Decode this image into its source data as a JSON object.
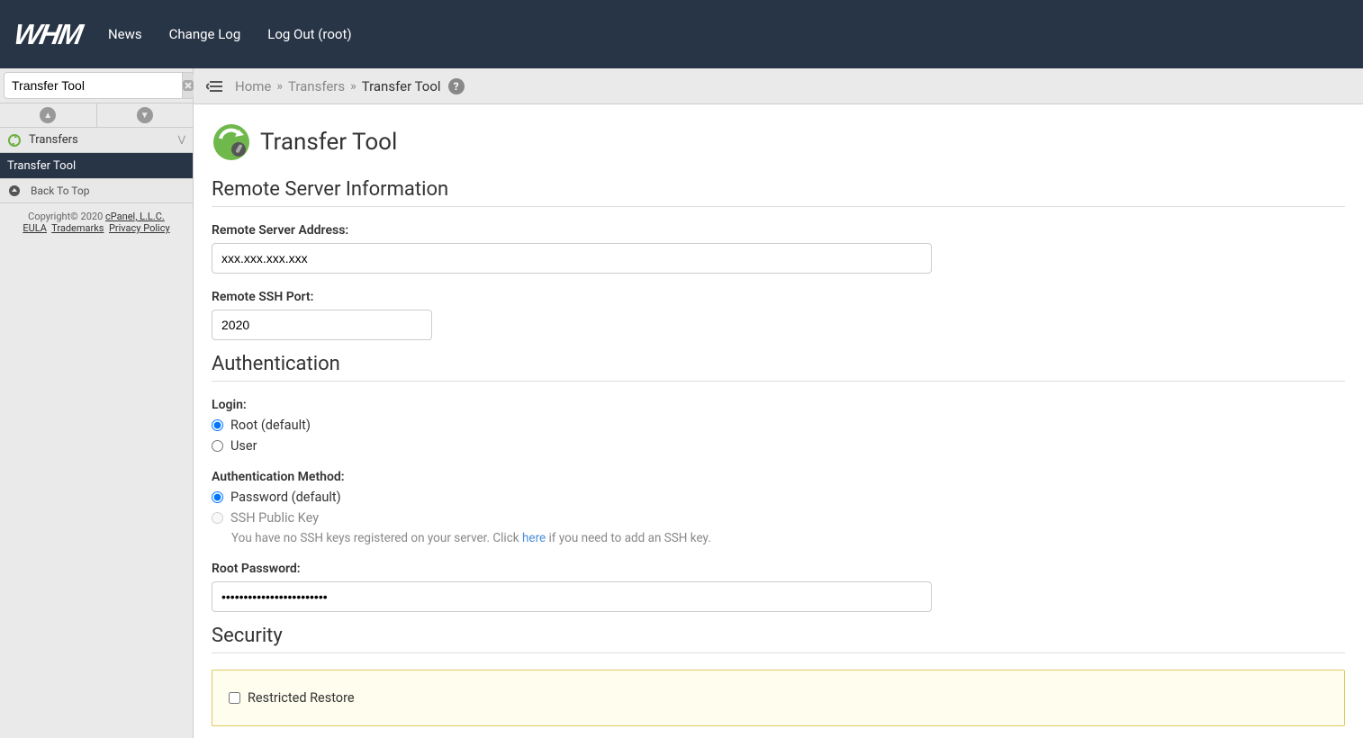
{
  "header": {
    "logo": "WHM",
    "nav": {
      "news": "News",
      "changelog": "Change Log",
      "logout": "Log Out (root)"
    }
  },
  "sidebar": {
    "search_value": "Transfer Tool",
    "category": "Transfers",
    "active_item": "Transfer Tool",
    "back_to_top": "Back To Top",
    "footer": {
      "copyright": "Copyright© 2020 ",
      "company_link": "cPanel, L.L.C.",
      "eula": "EULA",
      "trademarks": "Trademarks",
      "privacy": "Privacy Policy"
    }
  },
  "breadcrumb": {
    "home": "Home",
    "transfers": "Transfers",
    "current": "Transfer Tool",
    "sep": "»"
  },
  "page": {
    "title": "Transfer Tool",
    "section_remote": "Remote Server Information",
    "label_address": "Remote Server Address:",
    "value_address": "xxx.xxx.xxx.xxx",
    "label_ssh_port": "Remote SSH Port:",
    "value_ssh_port": "2020",
    "section_auth": "Authentication",
    "label_login": "Login:",
    "radio_root": "Root (default)",
    "radio_user": "User",
    "label_auth_method": "Authentication Method:",
    "radio_password": "Password (default)",
    "radio_sshkey": "SSH Public Key",
    "sshkey_help_before": "You have no SSH keys registered on your server. Click ",
    "sshkey_help_link": "here",
    "sshkey_help_after": " if you need to add an SSH key.",
    "label_root_pw": "Root Password:",
    "value_root_pw": "••••••••••••••••••••••••",
    "section_security": "Security",
    "checkbox_restricted": "Restricted Restore"
  }
}
